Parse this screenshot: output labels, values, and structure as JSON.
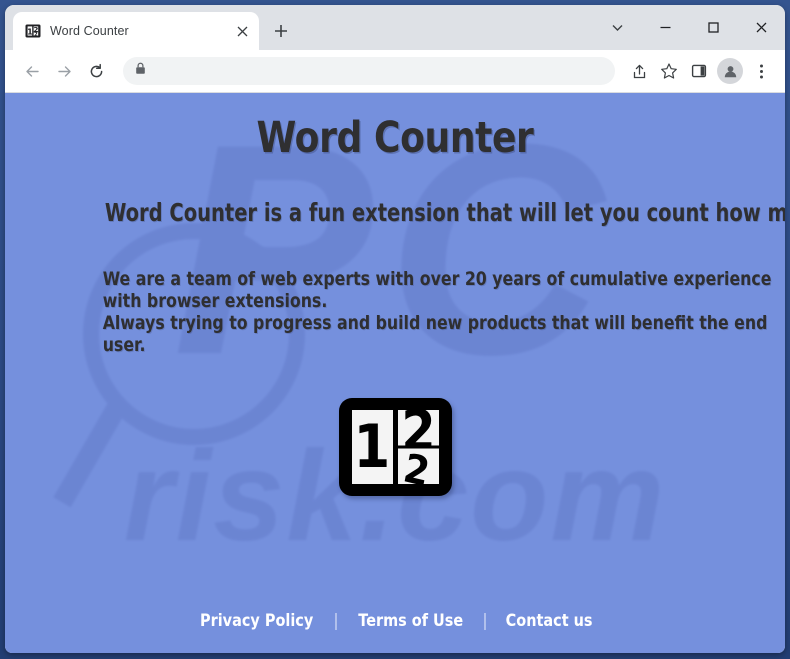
{
  "browser": {
    "tab": {
      "title": "Word Counter",
      "favicon_name": "word-counter-logo-icon",
      "close_label": "✕"
    },
    "new_tab_label": "+",
    "window_controls": {
      "tab_search_label": "⌄",
      "minimize_label": "–",
      "maximize_label": "□",
      "close_label": "✕"
    },
    "toolbar": {
      "back_label": "←",
      "forward_label": "→",
      "reload_label": "⟳",
      "omnibox_value": "",
      "omnibox_placeholder": "",
      "lock_icon_name": "lock-icon",
      "share_icon_name": "share-icon",
      "bookmark_icon_name": "star-icon",
      "side_panel_icon_name": "side-panel-icon",
      "profile_icon_name": "profile-avatar-icon",
      "menu_icon_name": "three-dot-menu-icon"
    }
  },
  "page": {
    "title": "Word Counter",
    "subtitle": "Word Counter is a fun extension that will let you count how many words appear in a page!",
    "paragraph_line1": "We are a team of web experts with over 20 years of cumulative experience with browser extensions.",
    "paragraph_line2": "Always trying to progress and build new products that will benefit the end user.",
    "logo": {
      "left_digit": "1",
      "right_digit_top": "2",
      "right_digit_bottom": "2"
    },
    "footer": {
      "links": [
        {
          "label": "Privacy Policy"
        },
        {
          "label": "Terms of Use"
        },
        {
          "label": "Contact us"
        }
      ],
      "separator": "|"
    },
    "watermark": {
      "brand": "PC",
      "domain": "risk.com"
    },
    "colors": {
      "page_background": "#7590dd",
      "text": "#2f2f31",
      "footer_link": "#ffffff",
      "window_frame": "#2c4a84",
      "tabstrip": "#dee1e6"
    }
  }
}
